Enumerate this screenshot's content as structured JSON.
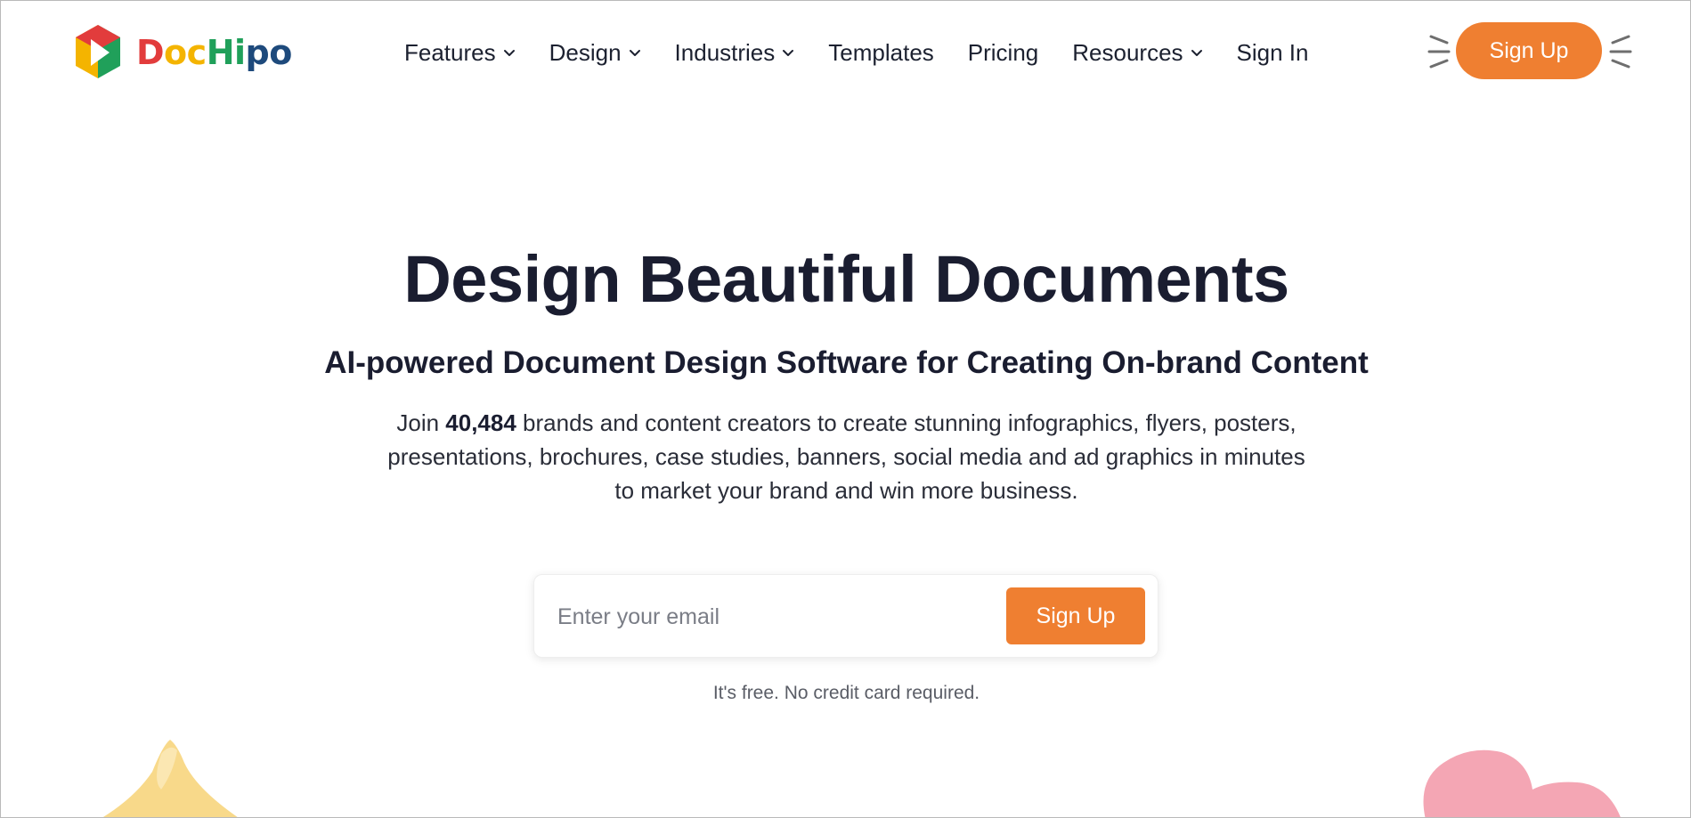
{
  "brand": {
    "name_parts": [
      "D",
      "oc",
      "Hi",
      "po"
    ],
    "logo_icon": "dochipo-play-logo-icon"
  },
  "nav": {
    "items": [
      {
        "label": "Features",
        "dropdown": true
      },
      {
        "label": "Design",
        "dropdown": true
      },
      {
        "label": "Industries",
        "dropdown": true
      },
      {
        "label": "Templates",
        "dropdown": false
      },
      {
        "label": "Pricing",
        "dropdown": false
      },
      {
        "label": "Resources",
        "dropdown": true
      },
      {
        "label": "Sign In",
        "dropdown": false
      }
    ],
    "signup_label": "Sign Up"
  },
  "hero": {
    "title": "Design Beautiful Documents",
    "subtitle": "AI-powered Document Design Software for Creating On-brand Content",
    "desc_prefix": "Join ",
    "desc_count": "40,484",
    "desc_suffix": " brands and content creators to create stunning infographics, flyers, posters, presentations, brochures, case studies, banners, social media and ad graphics in minutes to market your brand and win more business."
  },
  "signup_form": {
    "email_placeholder": "Enter your email",
    "email_value": "",
    "button_label": "Sign Up",
    "note": "It's free. No credit card required."
  },
  "colors": {
    "accent": "#ef7f31",
    "text_dark": "#1a1d30",
    "logo_red": "#e23c3c",
    "logo_yellow": "#f4b400",
    "logo_green": "#20a05a",
    "logo_blue": "#1e4a7c"
  }
}
